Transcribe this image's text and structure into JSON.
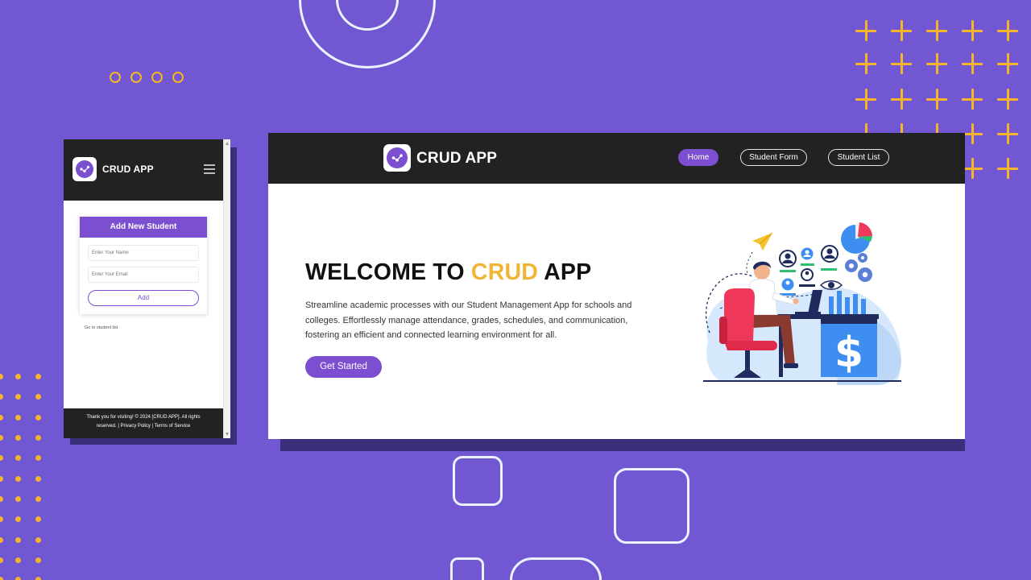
{
  "colors": {
    "background": "#7158d2",
    "accent_purple": "#7b4fd0",
    "accent_yellow": "#f0b537",
    "header_dark": "#222222",
    "decor_orange": "#f4b52b"
  },
  "mobile": {
    "brand": "CRUD APP",
    "menu_icon": "hamburger-menu-icon",
    "form": {
      "title": "Add New Student",
      "name_placeholder": "Enter Your Name",
      "email_placeholder": "Enter Your Email",
      "submit_label": "Add"
    },
    "link_label": "Go to student list",
    "footer": {
      "line1": "Thank you for visiting! © 2024 [CRUD APP]. All rights",
      "line2": "reserved. | Privacy Policy | Terms of Service"
    }
  },
  "desktop": {
    "brand": "CRUD APP",
    "nav": [
      {
        "label": "Home",
        "active": true
      },
      {
        "label": "Student Form",
        "active": false
      },
      {
        "label": "Student List",
        "active": false
      }
    ],
    "hero": {
      "title_part1": "WELCOME TO ",
      "title_accent": "CRUD",
      "title_part2": " APP",
      "description": "Streamline academic processes with our Student Management App for schools and colleges. Effortlessly manage attendance, grades, schedules, and communication, fostering an efficient and connected learning environment for all.",
      "cta_label": "Get Started"
    },
    "illustration_icon": "person-at-desk-analytics-illustration"
  }
}
